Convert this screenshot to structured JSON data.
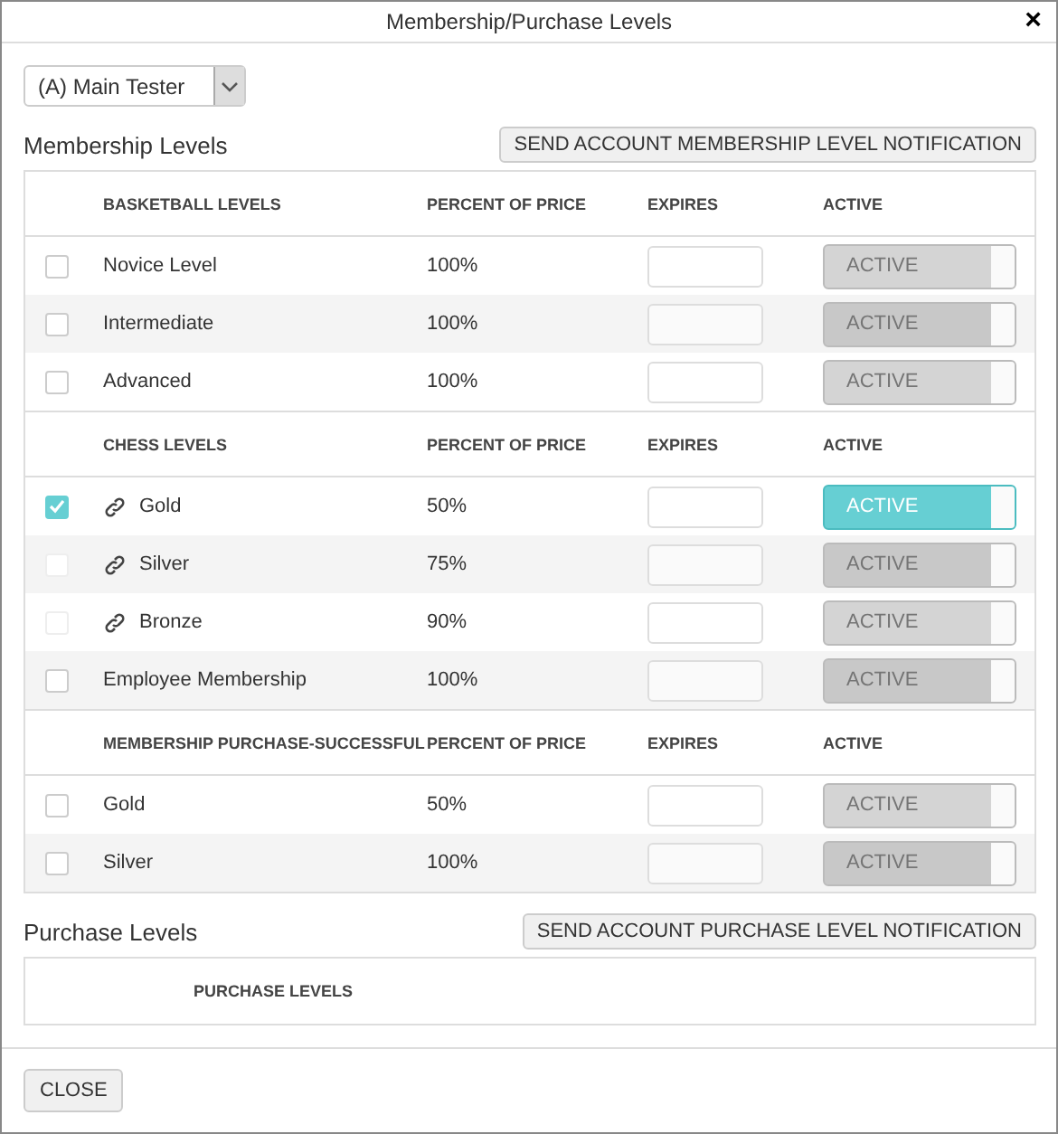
{
  "window": {
    "title": "Membership/Purchase Levels",
    "close": "×"
  },
  "account_select": {
    "value": "(A) Main Tester"
  },
  "membership": {
    "title": "Membership Levels",
    "button": "SEND ACCOUNT MEMBERSHIP LEVEL NOTIFICATION",
    "groups": [
      {
        "columns": [
          "BASKETBALL LEVELS",
          "PERCENT OF PRICE",
          "EXPIRES",
          "ACTIVE"
        ],
        "rows": [
          {
            "name": "Novice Level",
            "percent": "100%",
            "linked": false,
            "checked": false,
            "disabled": false,
            "toggle": "ACTIVE",
            "on": false
          },
          {
            "name": "Intermediate",
            "percent": "100%",
            "linked": false,
            "checked": false,
            "disabled": false,
            "toggle": "ACTIVE",
            "on": false
          },
          {
            "name": "Advanced",
            "percent": "100%",
            "linked": false,
            "checked": false,
            "disabled": false,
            "toggle": "ACTIVE",
            "on": false
          }
        ]
      },
      {
        "columns": [
          "CHESS LEVELS",
          "PERCENT OF PRICE",
          "EXPIRES",
          "ACTIVE"
        ],
        "rows": [
          {
            "name": "Gold",
            "percent": "50%",
            "linked": true,
            "checked": true,
            "disabled": false,
            "toggle": "ACTIVE",
            "on": true
          },
          {
            "name": "Silver",
            "percent": "75%",
            "linked": true,
            "checked": false,
            "disabled": true,
            "toggle": "ACTIVE",
            "on": false
          },
          {
            "name": "Bronze",
            "percent": "90%",
            "linked": true,
            "checked": false,
            "disabled": true,
            "toggle": "ACTIVE",
            "on": false
          },
          {
            "name": "Employee Membership",
            "percent": "100%",
            "linked": false,
            "checked": false,
            "disabled": false,
            "toggle": "ACTIVE",
            "on": false
          }
        ]
      },
      {
        "columns": [
          "MEMBERSHIP PURCHASE-SUCCESSFUL",
          "PERCENT OF PRICE",
          "EXPIRES",
          "ACTIVE"
        ],
        "rows": [
          {
            "name": "Gold",
            "percent": "50%",
            "linked": false,
            "checked": false,
            "disabled": false,
            "toggle": "ACTIVE",
            "on": false
          },
          {
            "name": "Silver",
            "percent": "100%",
            "linked": false,
            "checked": false,
            "disabled": false,
            "toggle": "ACTIVE",
            "on": false
          }
        ]
      }
    ]
  },
  "purchase": {
    "title": "Purchase Levels",
    "button": "SEND ACCOUNT PURCHASE LEVEL NOTIFICATION",
    "columns": [
      "PURCHASE LEVELS"
    ]
  },
  "footer": {
    "button": "CLOSE"
  }
}
